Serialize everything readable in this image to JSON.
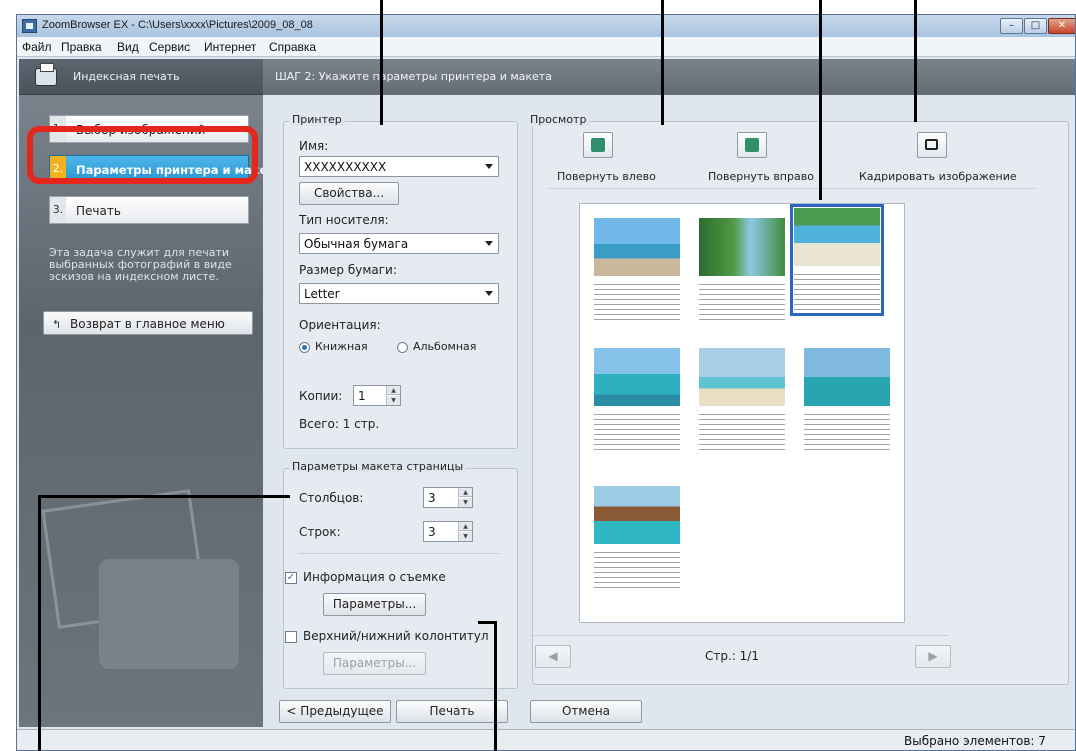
{
  "window": {
    "title": "ZoomBrowser EX - C:\\Users\\xxxx\\Pictures\\2009_08_08",
    "controls": {
      "minimize": "–",
      "maximize": "□",
      "close": "✕"
    }
  },
  "menubar": [
    "Файл",
    "Правка",
    "Вид",
    "Сервис",
    "Интернет",
    "Справка"
  ],
  "sidebar": {
    "header": "Индексная печать",
    "steps": [
      {
        "num": "1.",
        "label": "Выбор изображений",
        "active": false
      },
      {
        "num": "2.",
        "label": "Параметры принтера и макета",
        "active": true
      },
      {
        "num": "3.",
        "label": "Печать",
        "active": false
      }
    ],
    "description": "Эта задача служит для печати выбранных фотографий в виде эскизов на индексном листе.",
    "back_button": "Возврат в главное меню"
  },
  "main": {
    "step_title": "ШАГ 2: Укажите параметры принтера и макета",
    "printer": {
      "group_title": "Принтер",
      "name_label": "Имя:",
      "name_value": "XXXXXXXXXX",
      "properties_button": "Свойства...",
      "media_label": "Тип носителя:",
      "media_value": "Обычная бумага",
      "paper_label": "Размер бумаги:",
      "paper_value": "Letter",
      "orientation_label": "Ориентация:",
      "orientation_portrait": "Книжная",
      "orientation_landscape": "Альбомная",
      "orientation_selected": "Книжная",
      "copies_label": "Копии:",
      "copies_value": "1",
      "total": "Всего: 1 стр."
    },
    "layout": {
      "group_title": "Параметры макета страницы",
      "columns_label": "Столбцов:",
      "columns_value": "3",
      "rows_label": "Строк:",
      "rows_value": "3",
      "shooting_info_label": "Информация о съемке",
      "shooting_info_checked": true,
      "shooting_info_button": "Параметры...",
      "header_footer_label": "Верхний/нижний колонтитул",
      "header_footer_checked": false,
      "header_footer_button": "Параметры..."
    },
    "preview": {
      "group_title": "Просмотр",
      "rotate_left": "Повернуть влево",
      "rotate_right": "Повернуть вправо",
      "crop": "Кадрировать изображение",
      "thumbnail_count": 7,
      "selected_thumbnail": 3,
      "page_label": "Стр.: 1/1",
      "prev_icon": "left-arrow-icon",
      "next_icon": "right-arrow-icon"
    },
    "bottom_buttons": {
      "previous": "< Предыдущее",
      "print": "Печать",
      "cancel": "Отмена"
    }
  },
  "statusbar": {
    "text": "Выбрано элементов: 7"
  },
  "colors": {
    "highlight_ring": "#e5261c",
    "active_step": "#2a94cf",
    "selection": "#2b66c2"
  }
}
